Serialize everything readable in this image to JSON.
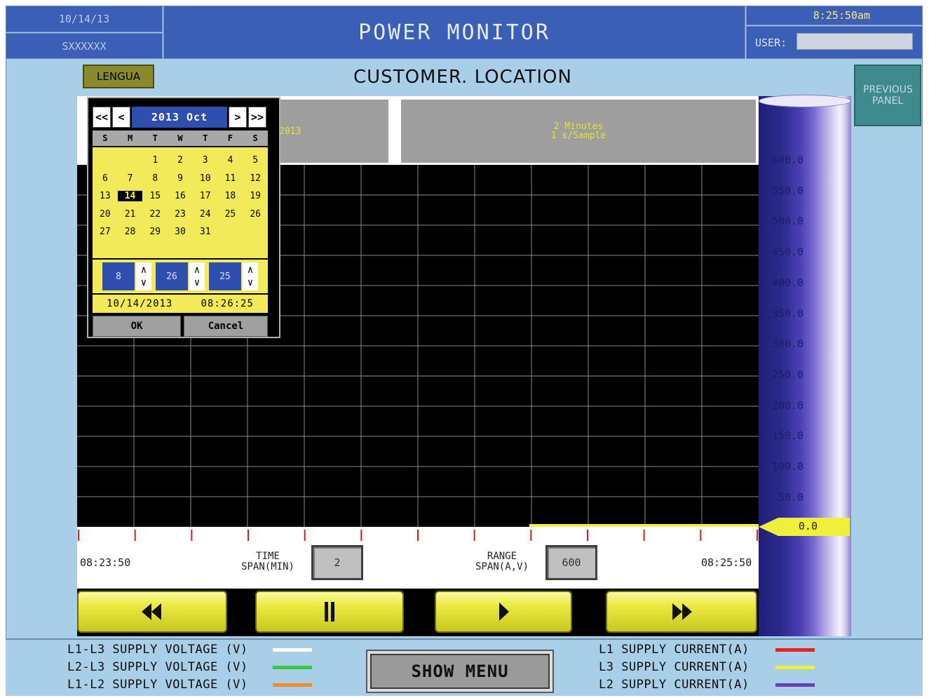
{
  "header": {
    "date": "10/14/13",
    "station_id": "SXXXXXX",
    "title": "POWER MONITOR",
    "clock": "8:25:50am",
    "user_label": "USER:",
    "user_value": ""
  },
  "subheader": {
    "language_button": "LENGUA",
    "location": "CUSTOMER. LOCATION",
    "previous_panel_button": "PREVIOUS PANEL"
  },
  "trend": {
    "start_info": "2013",
    "span_line1": "2 Minutes",
    "span_line2": "1 s/Sample",
    "y_ticks": [
      "600.0",
      "550.0",
      "500.0",
      "450.0",
      "400.0",
      "350.0",
      "300.0",
      "250.0",
      "200.0",
      "150.0",
      "100.0",
      "50.0"
    ],
    "current_value": "0.0",
    "time_start": "08:23:50",
    "time_end": "08:25:50",
    "time_span_label_1": "TIME",
    "time_span_label_2": "SPAN(MIN)",
    "time_span_value": "2",
    "range_span_label_1": "RANGE",
    "range_span_label_2": "SPAN(A,V)",
    "range_span_value": "600"
  },
  "transport": {
    "rewind_icon": "fast-rewind-icon",
    "pause_icon": "pause-icon",
    "play_icon": "play-icon",
    "forward_icon": "fast-forward-icon"
  },
  "calendar": {
    "nav_first": "<<",
    "nav_prev": "<",
    "month_label": "2013 Oct",
    "nav_next": ">",
    "nav_last": ">>",
    "weekdays": [
      "S",
      "M",
      "T",
      "W",
      "T",
      "F",
      "S"
    ],
    "days": [
      "",
      "",
      "1",
      "2",
      "3",
      "4",
      "5",
      "6",
      "7",
      "8",
      "9",
      "10",
      "11",
      "12",
      "13",
      "14",
      "15",
      "16",
      "17",
      "18",
      "19",
      "20",
      "21",
      "22",
      "23",
      "24",
      "25",
      "26",
      "27",
      "28",
      "29",
      "30",
      "31"
    ],
    "selected_day": "14",
    "hour": "8",
    "minute": "26",
    "second": "25",
    "date_readout": "10/14/2013",
    "time_readout": "08:26:25",
    "ok_label": "OK",
    "cancel_label": "Cancel"
  },
  "legend": {
    "left": [
      {
        "label": "L1-L3 SUPPLY VOLTAGE (V)",
        "color": "#ffffff"
      },
      {
        "label": "L2-L3 SUPPLY VOLTAGE (V)",
        "color": "#3cc83c"
      },
      {
        "label": "L1-L2 SUPPLY VOLTAGE (V)",
        "color": "#f08a2a"
      }
    ],
    "right": [
      {
        "label": "L1 SUPPLY CURRENT(A)",
        "color": "#e82020"
      },
      {
        "label": "L3 SUPPLY CURRENT(A)",
        "color": "#f0f03a"
      },
      {
        "label": "L2 SUPPLY CURRENT(A)",
        "color": "#6a3cc8"
      }
    ],
    "show_menu": "SHOW MENU"
  }
}
